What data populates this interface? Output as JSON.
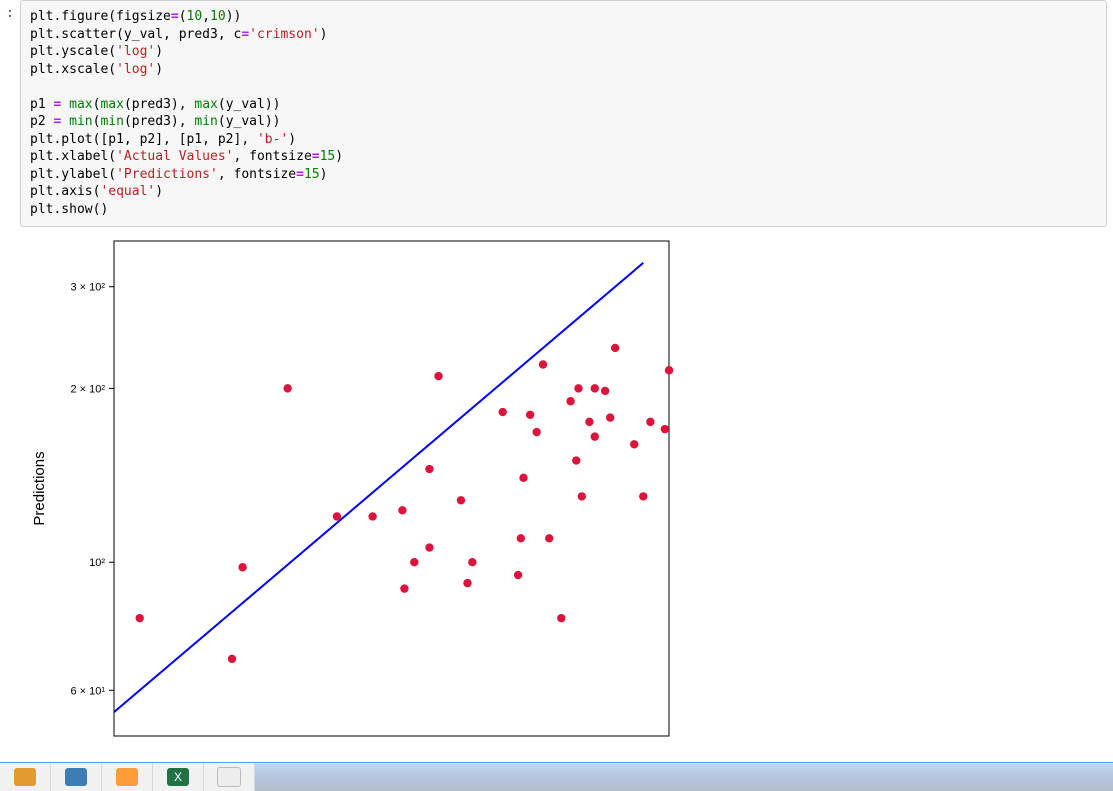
{
  "cell": {
    "prompt": ":",
    "code": {
      "l1": {
        "a": "plt.figure(figsize",
        "b": "=",
        "c": "(",
        "d": "10",
        "e": ",",
        "f": "10",
        "g": "))"
      },
      "l2": {
        "a": "plt.scatter(y_val, pred3, c",
        "b": "=",
        "c": "'crimson'",
        "d": ")"
      },
      "l3": {
        "a": "plt.yscale(",
        "b": "'log'",
        "c": ")"
      },
      "l4": {
        "a": "plt.xscale(",
        "b": "'log'",
        "c": ")"
      },
      "l5": {
        "a": "p1 ",
        "b": "=",
        "c": " ",
        "d": "max",
        "e": "(",
        "f": "max",
        "g": "(pred3), ",
        "h": "max",
        "i": "(y_val))"
      },
      "l6": {
        "a": "p2 ",
        "b": "=",
        "c": " ",
        "d": "min",
        "e": "(",
        "f": "min",
        "g": "(pred3), ",
        "h": "min",
        "i": "(y_val))"
      },
      "l7": {
        "a": "plt.plot([p1, p2], [p1, p2], ",
        "b": "'b-'",
        "c": ")"
      },
      "l8": {
        "a": "plt.xlabel(",
        "b": "'Actual Values'",
        "c": ", fontsize",
        "d": "=",
        "e": "15",
        "f": ")"
      },
      "l9": {
        "a": "plt.ylabel(",
        "b": "'Predictions'",
        "c": ", fontsize",
        "d": "=",
        "e": "15",
        "f": ")"
      },
      "l10": {
        "a": "plt.axis(",
        "b": "'equal'",
        "c": ")"
      },
      "l11": {
        "a": "plt.show()"
      }
    }
  },
  "chart_data": {
    "type": "scatter",
    "ylabel": "Predictions",
    "xlabel": "",
    "xscale": "log",
    "yscale": "log",
    "y_ticks": [
      {
        "value": 60,
        "label": "6 × 10¹"
      },
      {
        "value": 100,
        "label": "10²"
      },
      {
        "value": 200,
        "label": "2 × 10²"
      },
      {
        "value": 300,
        "label": "3 × 10²"
      }
    ],
    "x_range": [
      55,
      360
    ],
    "y_range": [
      50,
      360
    ],
    "identity_line": {
      "p1": [
        55,
        55
      ],
      "p2": [
        330,
        330
      ],
      "color": "#0000ff"
    },
    "scatter_color": "#dc143c",
    "points": [
      [
        60,
        80
      ],
      [
        82,
        68
      ],
      [
        85,
        98
      ],
      [
        99,
        200
      ],
      [
        117,
        120
      ],
      [
        132,
        120
      ],
      [
        146,
        123
      ],
      [
        147,
        90
      ],
      [
        152,
        100
      ],
      [
        160,
        106
      ],
      [
        160,
        145
      ],
      [
        165,
        210
      ],
      [
        178,
        128
      ],
      [
        182,
        92
      ],
      [
        185,
        100
      ],
      [
        205,
        182
      ],
      [
        216,
        95
      ],
      [
        218,
        110
      ],
      [
        220,
        140
      ],
      [
        225,
        180
      ],
      [
        230,
        168
      ],
      [
        235,
        220
      ],
      [
        240,
        110
      ],
      [
        250,
        80
      ],
      [
        258,
        190
      ],
      [
        263,
        150
      ],
      [
        265,
        200
      ],
      [
        268,
        130
      ],
      [
        275,
        175
      ],
      [
        280,
        165
      ],
      [
        280,
        200
      ],
      [
        290,
        198
      ],
      [
        295,
        178
      ],
      [
        300,
        235
      ],
      [
        320,
        160
      ],
      [
        330,
        130
      ],
      [
        338,
        175
      ],
      [
        355,
        170
      ],
      [
        360,
        215
      ]
    ]
  },
  "taskbar": {
    "items": [
      "file-explorer-icon",
      "browser-icon",
      "media-icon",
      "excel-icon",
      "document-icon"
    ]
  }
}
